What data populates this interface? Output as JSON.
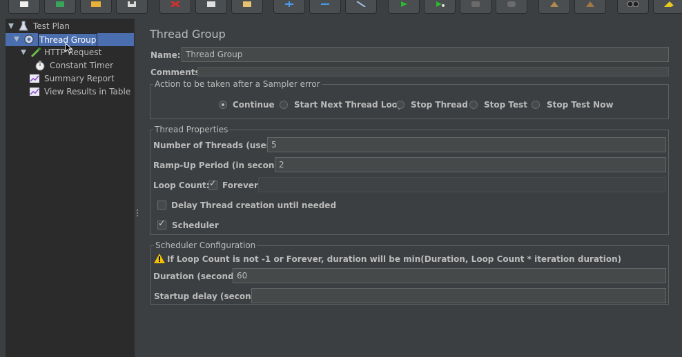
{
  "tree": {
    "items": [
      {
        "label": "Test Plan",
        "icon": "test-plan-icon"
      },
      {
        "label": "Thread Group",
        "icon": "gear-icon"
      },
      {
        "label": "HTTP Request",
        "icon": "pipette-icon"
      },
      {
        "label": "Constant Timer",
        "icon": "stopwatch-icon"
      },
      {
        "label": "Summary Report",
        "icon": "chart-icon"
      },
      {
        "label": "View Results in Table",
        "icon": "chart-icon"
      }
    ]
  },
  "panel": {
    "title": "Thread Group",
    "name_label": "Name:",
    "name_value": "Thread Group",
    "comments_label": "Comments:",
    "comments_value": "",
    "error_group": {
      "title": "Action to be taken after a Sampler error",
      "options": [
        "Continue",
        "Start Next Thread Loop",
        "Stop Thread",
        "Stop Test",
        "Stop Test Now"
      ],
      "selected": "Continue"
    },
    "thread_props": {
      "title": "Thread Properties",
      "threads_label": "Number of Threads (users):",
      "threads_value": "5",
      "rampup_label": "Ramp-Up Period (in seconds):",
      "rampup_value": "2",
      "loop_label": "Loop Count:",
      "forever_label": "Forever",
      "forever_checked": true,
      "loop_value": "",
      "delay_label": "Delay Thread creation until needed",
      "delay_checked": false,
      "scheduler_label": "Scheduler",
      "scheduler_checked": true
    },
    "scheduler_config": {
      "title": "Scheduler Configuration",
      "warning": "If Loop Count is not -1 or Forever, duration will be min(Duration, Loop Count * iteration duration)",
      "duration_label": "Duration (seconds)",
      "duration_value": "60",
      "startup_label": "Startup delay (seconds)",
      "startup_value": ""
    }
  },
  "toolbar": {
    "icons": [
      "new-icon",
      "templates-icon",
      "open-icon",
      "save-icon",
      "cut-icon",
      "copy-icon",
      "paste-icon",
      "expand-icon",
      "collapse-icon",
      "toggle-icon",
      "start-icon",
      "start-no-pause-icon",
      "stop-icon",
      "shutdown-icon",
      "clear-icon",
      "clear-all-icon",
      "search-icon",
      "reset-search-icon"
    ]
  },
  "colors": {
    "background": "#3c3f41",
    "tree_background": "#2b2b2b",
    "selection": "#4b6eaf",
    "field_background": "#45494a",
    "text": "#bbbbbb",
    "start_green": "#2eb82e",
    "plus_blue": "#4a9cf0"
  }
}
